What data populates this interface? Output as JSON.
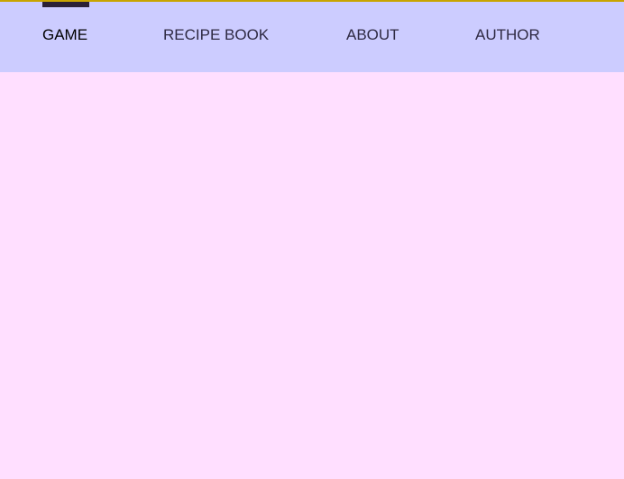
{
  "nav": {
    "items": [
      {
        "label": "GAME",
        "active": true
      },
      {
        "label": "RECIPE BOOK",
        "active": false
      },
      {
        "label": "ABOUT",
        "active": false
      },
      {
        "label": "AUTHOR",
        "active": false
      }
    ]
  },
  "colors": {
    "nav_background": "#ccccff",
    "page_background": "#ffdfff",
    "top_rule": "#c8a400",
    "active_indicator": "#2b2136",
    "nav_text": "#2f2a43"
  }
}
